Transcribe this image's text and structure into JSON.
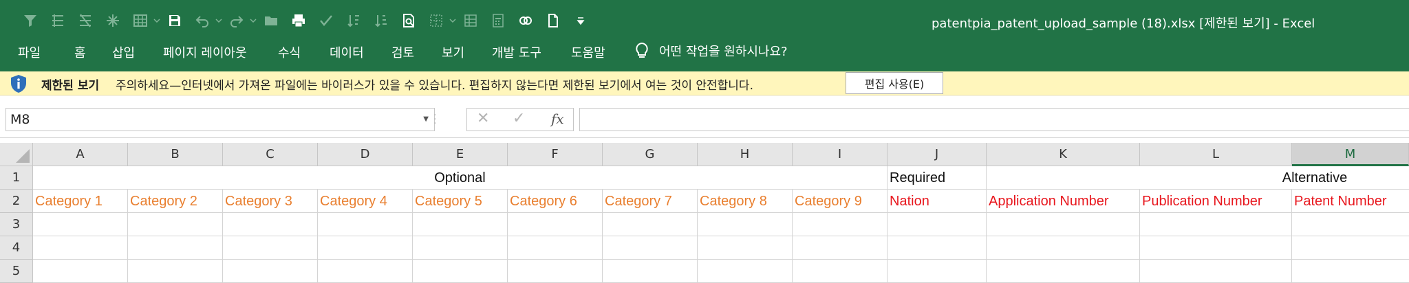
{
  "window": {
    "title": "patentpia_patent_upload_sample (18).xlsx  [제한된 보기]  -  Excel",
    "accent": "#217346"
  },
  "quick_access": {
    "icons": [
      "filter-icon",
      "group-icon",
      "ungroup-icon",
      "freeze-icon",
      "table-icon",
      "save-icon",
      "undo-icon",
      "redo-icon",
      "open-folder-icon",
      "print-icon",
      "check-icon",
      "sort-ascending-icon",
      "sort-descending-icon",
      "print-preview-icon",
      "border-icon",
      "grid-icon",
      "calculator-icon",
      "link-icon",
      "new-file-icon",
      "customize-icon"
    ]
  },
  "ribbon": {
    "tabs": [
      "파일",
      "홈",
      "삽입",
      "페이지 레이아웃",
      "수식",
      "데이터",
      "검토",
      "보기",
      "개발 도구",
      "도움말"
    ],
    "tell_me": "어떤 작업을 원하시나요?"
  },
  "message_bar": {
    "title": "제한된 보기",
    "text": "주의하세요—인터넷에서 가져온 파일에는 바이러스가 있을 수 있습니다. 편집하지 않는다면 제한된 보기에서 여는 것이 안전합니다.",
    "button": "편집 사용(E)"
  },
  "formula_bar": {
    "name_box": "M8",
    "cancel": "✕",
    "enter": "✓",
    "fx": "fx",
    "value": ""
  },
  "sheet": {
    "columns": [
      "A",
      "B",
      "C",
      "D",
      "E",
      "F",
      "G",
      "H",
      "I",
      "J",
      "K",
      "L",
      "M"
    ],
    "rows": [
      "1",
      "2",
      "3",
      "4",
      "5"
    ],
    "selected_column": "M",
    "row1": {
      "optional": "Optional",
      "required": "Required",
      "alternative": "Alternative"
    },
    "row2": {
      "A": "Category 1",
      "B": "Category 2",
      "C": "Category 3",
      "D": "Category 4",
      "E": "Category 5",
      "F": "Category 6",
      "G": "Category 7",
      "H": "Category 8",
      "I": "Category 9",
      "J": "Nation",
      "K": "Application Number",
      "L": "Publication Number",
      "M": "Patent Number"
    },
    "colors": {
      "optional_text": "#e97f2f",
      "required_text": "#e8171e"
    }
  }
}
